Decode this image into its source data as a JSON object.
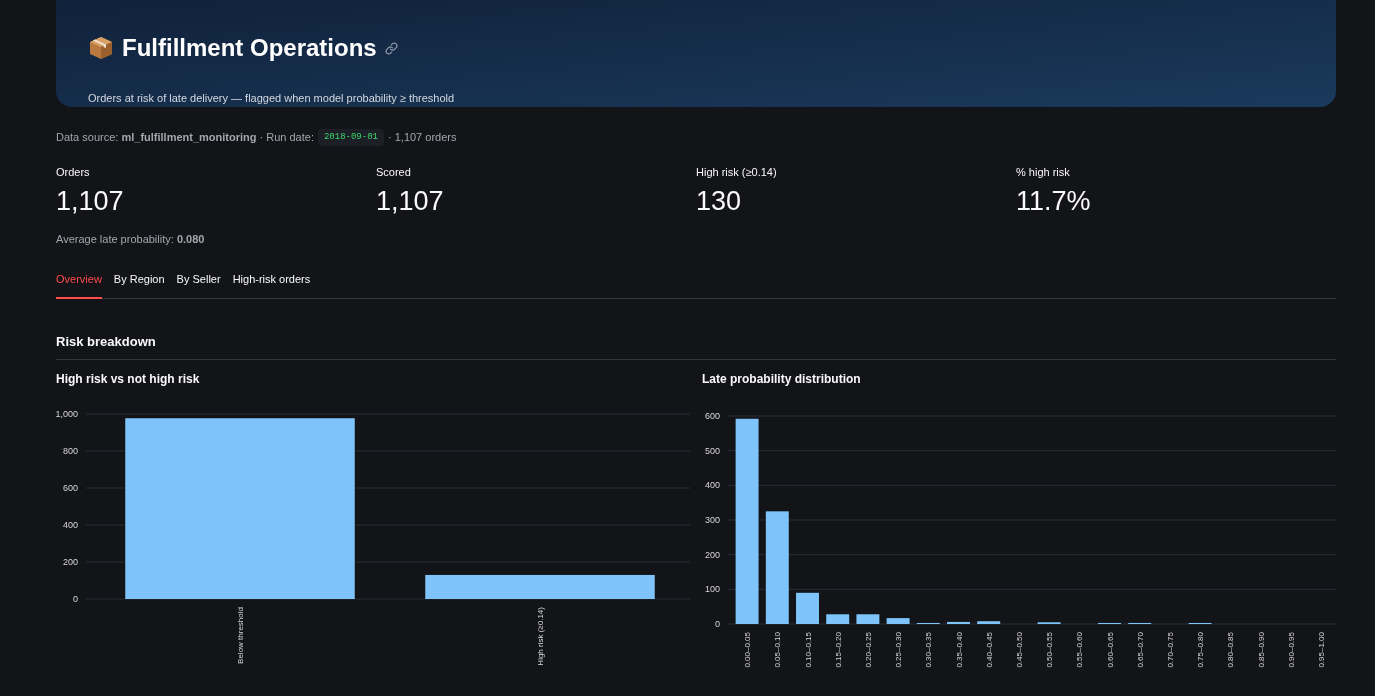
{
  "header": {
    "title": "Fulfillment Operations",
    "subtitle": "Orders at risk of late delivery — flagged when model probability ≥ threshold"
  },
  "source_line": {
    "before": "Data source: **ml_fulfillment_monitoring** · Run date:",
    "run_date": "2018-09-01",
    "after": "· 1,107 orders"
  },
  "metrics": [
    {
      "label": "Orders",
      "value": "1,107"
    },
    {
      "label": "Scored",
      "value": "1,107"
    },
    {
      "label": "High risk (≥0.14)",
      "value": "130"
    },
    {
      "label": "% high risk",
      "value": "11.7%"
    }
  ],
  "average_note": "Average late probability: **0.080**",
  "tabs": [
    {
      "label": "Overview",
      "selected": true
    },
    {
      "label": "By Region",
      "selected": false
    },
    {
      "label": "By Seller",
      "selected": false
    },
    {
      "label": "High-risk orders",
      "selected": false
    }
  ],
  "section_title": "Risk breakdown",
  "charts": [
    {
      "title": "High risk vs not high risk",
      "chart_data": {
        "type": "bar",
        "categories": [
          "Below threshold",
          "High risk (≥0.14)"
        ],
        "grid": true,
        "series": [
          {
            "color": "#7ec4fa",
            "values": [
              977,
              130
            ]
          }
        ],
        "ylim": [
          0,
          1000
        ],
        "yticks": [
          {
            "value": 0,
            "label": "0"
          },
          {
            "value": 200,
            "label": "200"
          },
          {
            "value": 400,
            "label": "400"
          },
          {
            "value": 600,
            "label": "600"
          },
          {
            "value": 800,
            "label": "800"
          },
          {
            "value": 1000,
            "label": "1,000"
          }
        ]
      }
    },
    {
      "title": "Late probability distribution",
      "chart_data": {
        "type": "bar",
        "categories": [
          "0.00–0.05",
          "0.05–0.10",
          "0.10–0.15",
          "0.15–0.20",
          "0.20–0.25",
          "0.25–0.30",
          "0.30–0.35",
          "0.35–0.40",
          "0.40–0.45",
          "0.45–0.50",
          "0.50–0.55",
          "0.55–0.60",
          "0.60–0.65",
          "0.65–0.70",
          "0.70–0.75",
          "0.75–0.80",
          "0.80–0.85",
          "0.85–0.90",
          "0.90–0.95",
          "0.95–1.00"
        ],
        "grid": true,
        "series": [
          {
            "color": "#7ec4fa",
            "values": [
              592,
              325,
              90,
              28,
              28,
              17,
              3,
              6,
              8,
              0,
              5,
              0,
              3,
              3,
              0,
              3,
              0,
              0,
              0,
              0
            ]
          }
        ],
        "ylim": [
          0,
          600
        ],
        "yticks": [
          {
            "value": 0,
            "label": "0"
          },
          {
            "value": 100,
            "label": "100"
          },
          {
            "value": 200,
            "label": "200"
          },
          {
            "value": 300,
            "label": "300"
          },
          {
            "value": 400,
            "label": "400"
          },
          {
            "value": 500,
            "label": "500"
          },
          {
            "value": 600,
            "label": "600"
          }
        ]
      }
    }
  ]
}
